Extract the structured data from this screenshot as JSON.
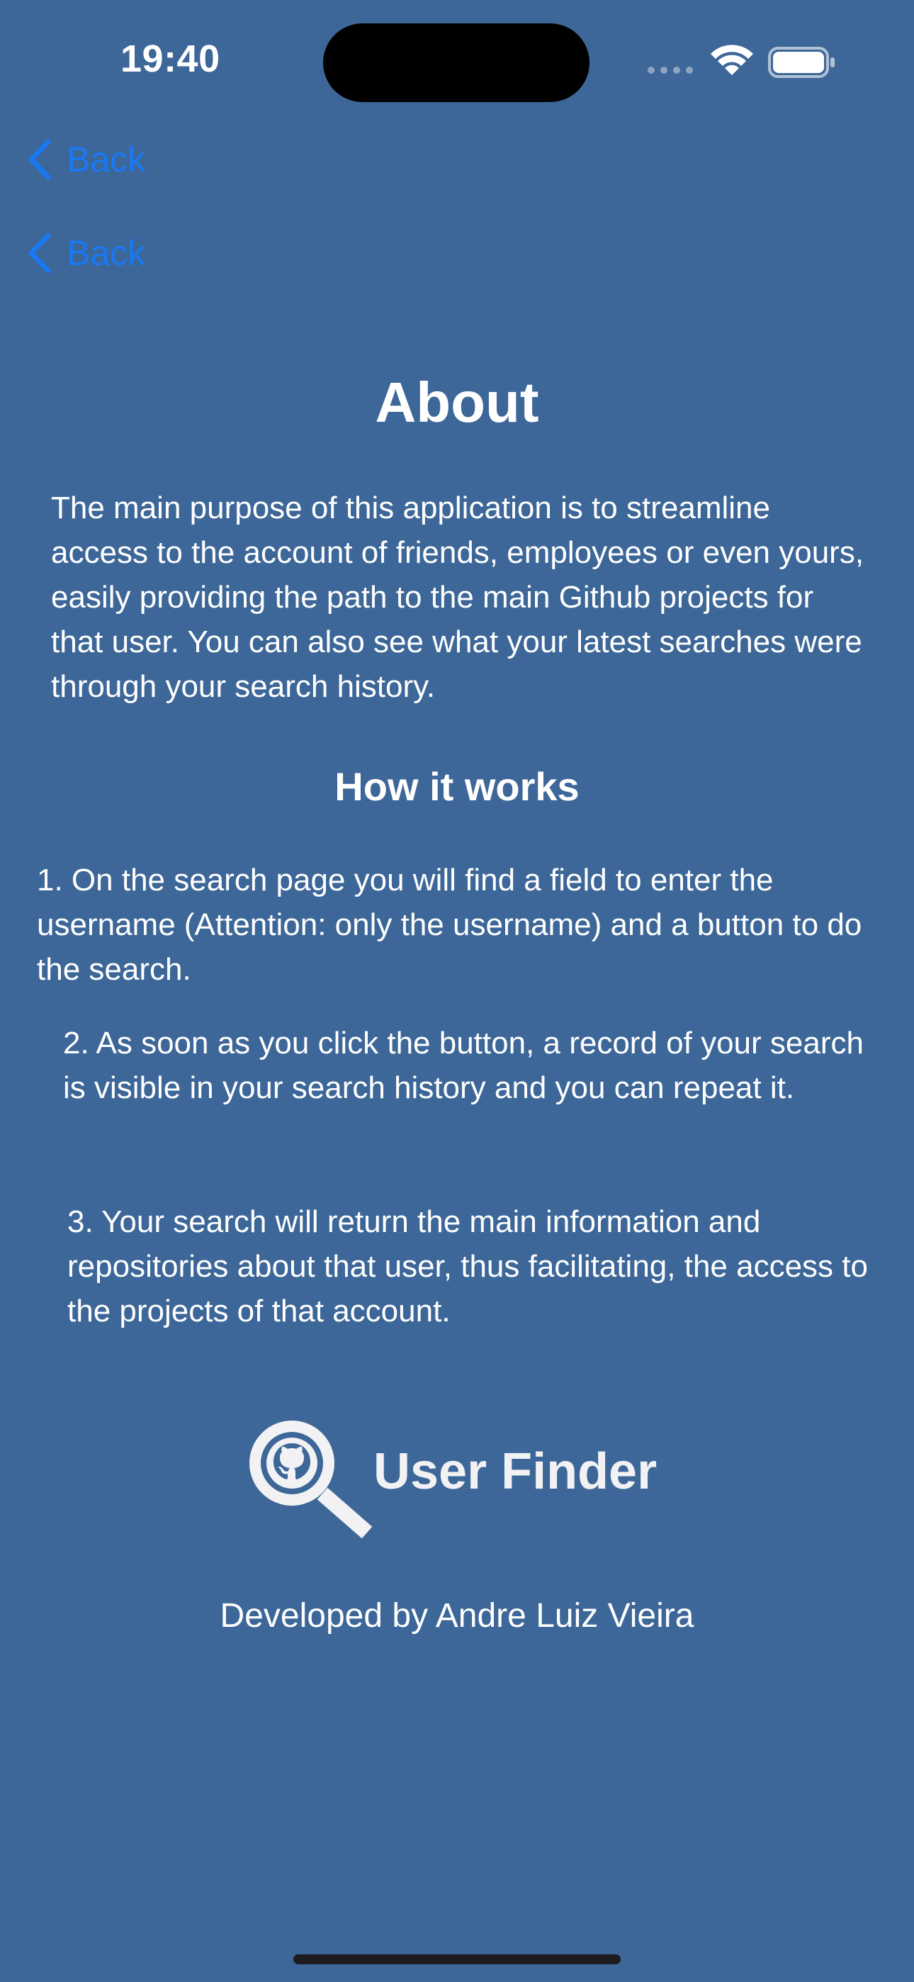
{
  "status_bar": {
    "time": "19:40"
  },
  "nav": {
    "back_labels": [
      "Back",
      "Back"
    ]
  },
  "about": {
    "title": "About",
    "text": "The main purpose of this application is to streamline access to the account of friends, employees or even yours, easily providing the path to the main Github projects for that user. You can also see what your latest searches were through your search history."
  },
  "how_it_works": {
    "title": "How it works",
    "steps": [
      "1. On the search page you will find a field to enter the username (Attention: only the username) and a button to do the search.",
      "2. As soon as you click the button, a record of your search is visible in your search history and you can repeat it.",
      "3. Your search will return the main information and repositories about that user, thus facilitating, the access to the projects of that account."
    ]
  },
  "logo": {
    "name": "User Finder",
    "icon": "github-magnifier-icon"
  },
  "footer": {
    "credit": "Developed by Andre Luiz Vieira"
  },
  "colors": {
    "background": "#3d6798",
    "link": "#1a78f2",
    "text": "#ffffff"
  }
}
